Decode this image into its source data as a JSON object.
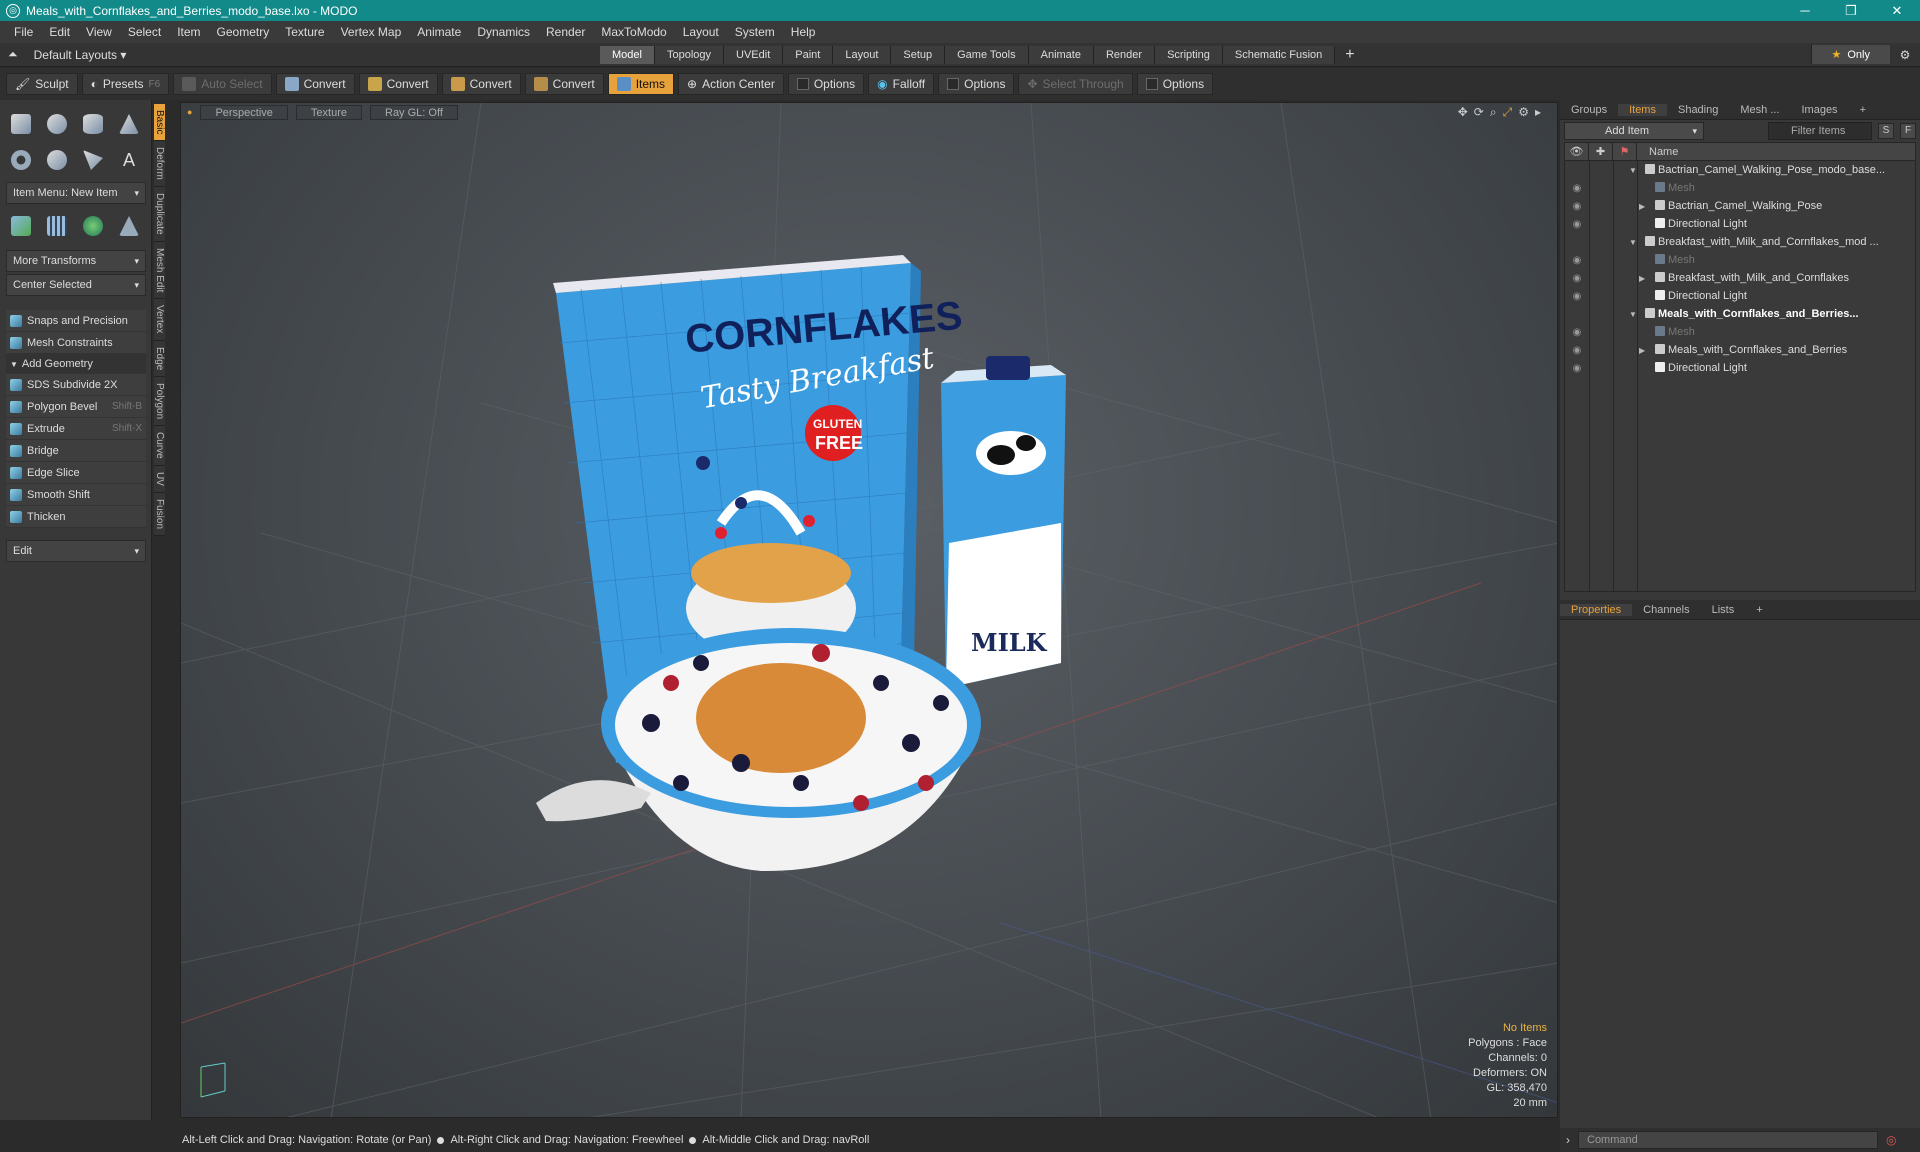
{
  "window": {
    "title": "Meals_with_Cornflakes_and_Berries_modo_base.lxo - MODO",
    "min": "─",
    "max": "❐",
    "close": "✕"
  },
  "menu": [
    "File",
    "Edit",
    "View",
    "Select",
    "Item",
    "Geometry",
    "Texture",
    "Vertex Map",
    "Animate",
    "Dynamics",
    "Render",
    "MaxToModo",
    "Layout",
    "System",
    "Help"
  ],
  "layout": {
    "default_layouts": "Default Layouts",
    "tabs": [
      "Model",
      "Topology",
      "UVEdit",
      "Paint",
      "Layout",
      "Setup",
      "Game Tools",
      "Animate",
      "Render",
      "Scripting",
      "Schematic Fusion"
    ],
    "active_tab": "Model",
    "only": "Only"
  },
  "toolbar": {
    "sculpt": "Sculpt",
    "presets": "Presets",
    "presets_key": "F6",
    "auto_select": "Auto Select",
    "convert1": "Convert",
    "convert2": "Convert",
    "convert3": "Convert",
    "convert4": "Convert",
    "items": "Items",
    "action_center": "Action Center",
    "options1": "Options",
    "falloff": "Falloff",
    "options2": "Options",
    "select_through": "Select Through",
    "options3": "Options"
  },
  "left_panel": {
    "item_menu": "Item Menu: New Item",
    "more_transforms": "More Transforms",
    "center_selected": "Center Selected",
    "snaps": "Snaps and Precision",
    "mesh_constraints": "Mesh Constraints",
    "add_geometry": "Add Geometry",
    "tools": [
      {
        "label": "SDS Subdivide 2X",
        "shortcut": ""
      },
      {
        "label": "Polygon Bevel",
        "shortcut": "Shift-B"
      },
      {
        "label": "Extrude",
        "shortcut": "Shift-X"
      },
      {
        "label": "Bridge",
        "shortcut": ""
      },
      {
        "label": "Edge Slice",
        "shortcut": ""
      },
      {
        "label": "Smooth Shift",
        "shortcut": ""
      },
      {
        "label": "Thicken",
        "shortcut": ""
      }
    ],
    "edit": "Edit"
  },
  "vertical_tabs": [
    "Basic",
    "Deform",
    "Duplicate",
    "Mesh Edit",
    "Vertex",
    "Edge",
    "Polygon",
    "Curve",
    "UV",
    "Fusion"
  ],
  "viewport": {
    "perspective": "Perspective",
    "texture": "Texture",
    "raygl": "Ray GL: Off",
    "hud": {
      "no_items": "No Items",
      "polygons": "Polygons : Face",
      "channels": "Channels: 0",
      "deformers": "Deformers: ON",
      "gl": "GL: 358,470",
      "scale": "20 mm"
    },
    "cereal_title": "CORNFLAKES",
    "cereal_sub": "Tasty Breakfast",
    "gluten_1": "GLUTEN",
    "gluten_2": "FREE",
    "milk": "MILK"
  },
  "right_panel": {
    "tabs": [
      "Groups",
      "Items",
      "Shading",
      "Mesh ...",
      "Images"
    ],
    "active_tab": "Items",
    "add_item": "Add Item",
    "filter_items": "Filter Items",
    "s_btn": "S",
    "f_btn": "F",
    "col_name": "Name",
    "tree": [
      {
        "label": "Bactrian_Camel_Walking_Pose_modo_base...",
        "level": 0,
        "kind": "scene",
        "arrow": "▼"
      },
      {
        "label": "Mesh",
        "level": 1,
        "kind": "mesh",
        "arrow": ""
      },
      {
        "label": "Bactrian_Camel_Walking_Pose",
        "level": 1,
        "kind": "group",
        "arrow": "▶"
      },
      {
        "label": "Directional Light",
        "level": 1,
        "kind": "light",
        "arrow": ""
      },
      {
        "label": "Breakfast_with_Milk_and_Cornflakes_mod ...",
        "level": 0,
        "kind": "scene",
        "arrow": "▼"
      },
      {
        "label": "Mesh",
        "level": 1,
        "kind": "mesh",
        "arrow": ""
      },
      {
        "label": "Breakfast_with_Milk_and_Cornflakes",
        "level": 1,
        "kind": "group",
        "arrow": "▶"
      },
      {
        "label": "Directional Light",
        "level": 1,
        "kind": "light",
        "arrow": ""
      },
      {
        "label": "Meals_with_Cornflakes_and_Berries...",
        "level": 0,
        "kind": "scene",
        "arrow": "▼",
        "bold": true
      },
      {
        "label": "Mesh",
        "level": 1,
        "kind": "mesh",
        "arrow": ""
      },
      {
        "label": "Meals_with_Cornflakes_and_Berries",
        "level": 1,
        "kind": "group",
        "arrow": "▶"
      },
      {
        "label": "Directional Light",
        "level": 1,
        "kind": "light",
        "arrow": ""
      }
    ],
    "props_tabs": [
      "Properties",
      "Channels",
      "Lists"
    ],
    "props_active": "Properties",
    "command_placeholder": "Command"
  },
  "status": {
    "hint1": "Alt-Left Click and Drag: Navigation: Rotate (or Pan)",
    "hint2": "Alt-Right Click and Drag: Navigation: Freewheel",
    "hint3": "Alt-Middle Click and Drag: navRoll"
  },
  "colors": {
    "accent": "#e8a23b",
    "title_bar": "#138a8a",
    "box_blue": "#4aa6e6"
  }
}
